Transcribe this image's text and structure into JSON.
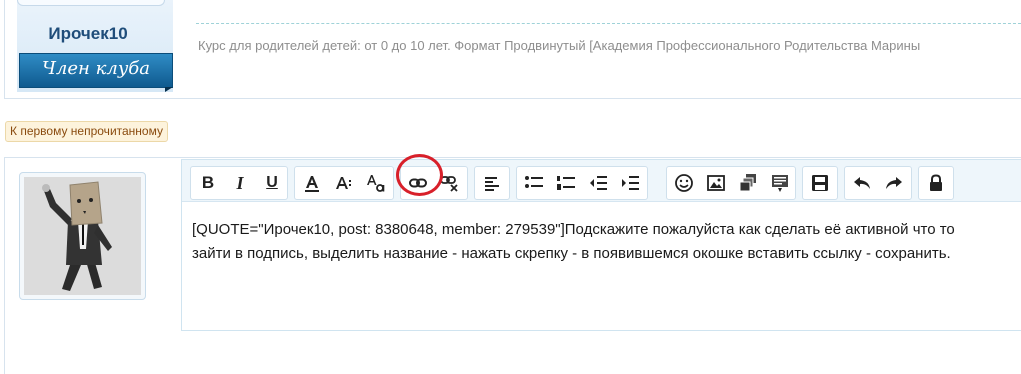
{
  "top_post": {
    "username": "Ирочек10",
    "member_label": "Член клуба",
    "signature": "Курс для родителей детей: от 0 до 10 лет. Формат Продвинутый [Академия Профессионального Родительства Марины"
  },
  "unread_button": {
    "label": "К первому непрочитанному"
  },
  "toolbar": {
    "bold": "B",
    "italic": "I",
    "underline": "U",
    "highlighted_button": "link-icon",
    "circle_color": "#d8202a"
  },
  "editor": {
    "line1": "[QUOTE=\"Ирочек10, post: 8380648, member: 279539\"]Подскажите пожалуйста как сделать её активной что то",
    "line2": "зайти в подпись, выделить название - нажать скрепку - в появившемся окошке вставить ссылку - сохранить."
  },
  "colors": {
    "username": "#1f4d7a",
    "banner": "#0f5a8f",
    "toolbar_bg": "#eef6fb"
  }
}
